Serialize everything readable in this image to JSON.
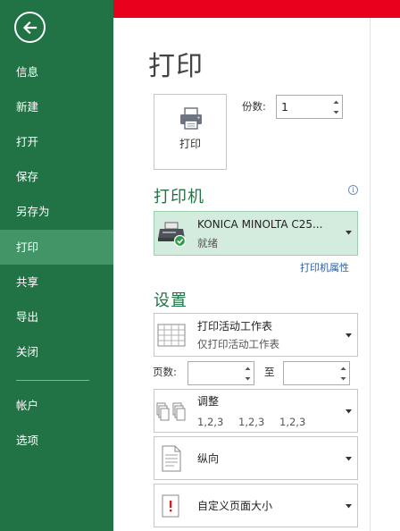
{
  "sidebar": {
    "items": [
      {
        "label": "信息",
        "active": false
      },
      {
        "label": "新建",
        "active": false
      },
      {
        "label": "打开",
        "active": false
      },
      {
        "label": "保存",
        "active": false
      },
      {
        "label": "另存为",
        "active": false
      },
      {
        "label": "打印",
        "active": true
      },
      {
        "label": "共享",
        "active": false
      },
      {
        "label": "导出",
        "active": false
      },
      {
        "label": "关闭",
        "active": false
      }
    ],
    "bottom_items": [
      {
        "label": "帐户"
      },
      {
        "label": "选项"
      }
    ]
  },
  "main": {
    "title": "打印",
    "print_button_label": "打印",
    "copies_label": "份数:",
    "copies_value": "1",
    "printer_section_title": "打印机",
    "printer": {
      "name": "KONICA MINOLTA C25...",
      "status": "就绪"
    },
    "printer_properties_link": "打印机属性",
    "settings_section_title": "设置",
    "settings": {
      "print_what": {
        "title": "打印活动工作表",
        "subtitle": "仅打印活动工作表"
      },
      "pages_label": "页数:",
      "to_label": "至",
      "pages_from": "",
      "pages_to": "",
      "collation": {
        "title": "调整",
        "sequence": [
          "1,2,3",
          "1,2,3",
          "1,2,3"
        ]
      },
      "orientation": {
        "title": "纵向"
      },
      "paper_size": {
        "title": "自定义页面大小"
      }
    }
  },
  "colors": {
    "sidebar_bg": "#217346",
    "sidebar_active": "#439467",
    "accent_red": "#e8001c",
    "section_title": "#217346",
    "link": "#2a5ea1"
  },
  "icons": [
    "back-arrow-icon",
    "printer-icon",
    "printer-device-icon",
    "check-status-icon",
    "info-icon",
    "sheet-grid-icon",
    "collate-pages-icon",
    "portrait-page-icon",
    "custom-page-size-icon",
    "dropdown-arrow-icon",
    "spin-up-icon",
    "spin-down-icon"
  ]
}
